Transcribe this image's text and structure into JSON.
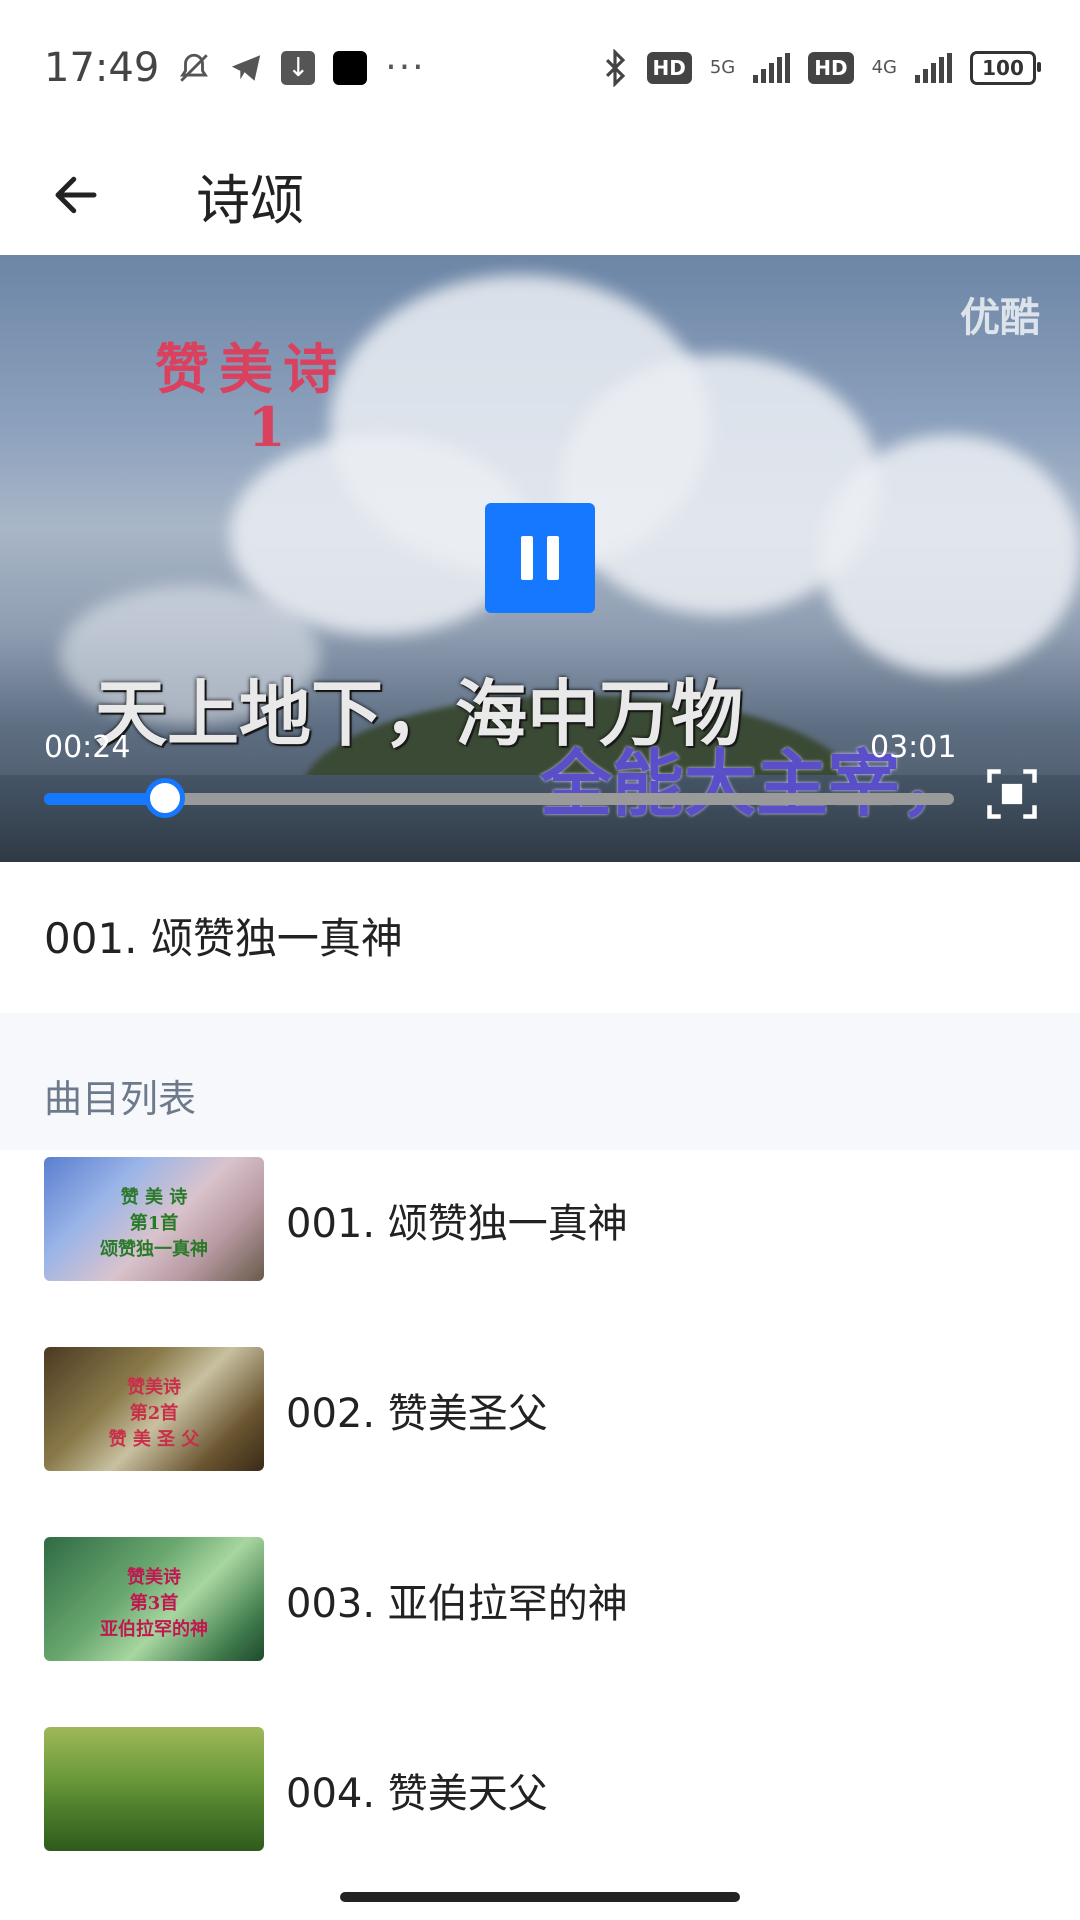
{
  "status_bar": {
    "time": "17:49",
    "net1": "5G",
    "net2": "4G",
    "hd": "HD",
    "battery": "100"
  },
  "app_bar": {
    "title": "诗颂"
  },
  "player": {
    "watermark": "优酷",
    "overlay_title": "赞美诗",
    "overlay_number": "1",
    "lyric_line1": "天上地下，海中万物",
    "lyric_line2": "全能大主宰，",
    "current_time": "00:24",
    "total_time": "03:01",
    "progress_fraction": 0.133,
    "accent_color": "#1677ff"
  },
  "now_playing": {
    "title": "001. 颂赞独一真神"
  },
  "section": {
    "label": "曲目列表"
  },
  "playlist": [
    {
      "title": "001. 颂赞独一真神",
      "thumb_text": "赞 美 诗\n第1首\n颂赞独一真神"
    },
    {
      "title": "002. 赞美圣父",
      "thumb_text": "赞美诗\n第2首\n赞 美 圣 父"
    },
    {
      "title": "003. 亚伯拉罕的神",
      "thumb_text": "赞美诗\n第3首\n亚伯拉罕的神"
    },
    {
      "title": "004. 赞美天父",
      "thumb_text": ""
    }
  ]
}
